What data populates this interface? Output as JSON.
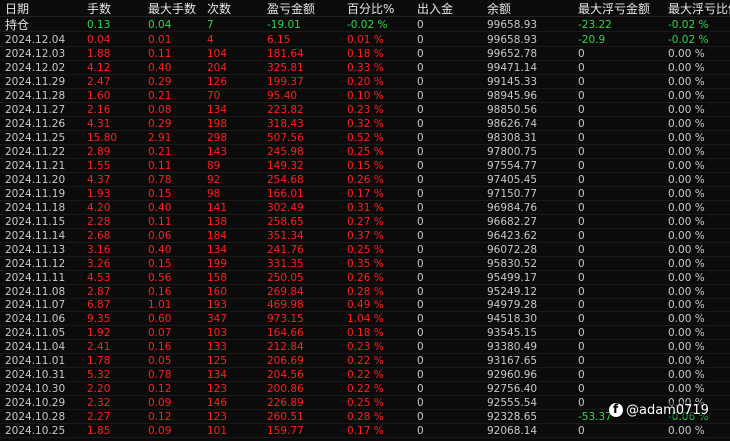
{
  "columns": [
    "日期",
    "手数",
    "最大手数",
    "次数",
    "盈亏金额",
    "百分比%",
    "出入金",
    "余额",
    "最大浮亏金额",
    "最大浮亏比例"
  ],
  "position_row": {
    "date": "持仓",
    "lots": "0.13",
    "max_lots": "0.04",
    "count": "7",
    "profit": "-19.01",
    "pct": "-0.02 %",
    "flow": "0",
    "balance": "99658.93",
    "max_float_loss": "-23.22",
    "max_float_loss_pct": "-0.02 %"
  },
  "rows": [
    {
      "date": "2024.12.04",
      "lots": "0.04",
      "max_lots": "0.01",
      "count": "4",
      "profit": "6.15",
      "pct": "0.01 %",
      "flow": "0",
      "balance": "99658.93",
      "max_float_loss": "-20.9",
      "max_float_loss_pct": "-0.02 %"
    },
    {
      "date": "2024.12.03",
      "lots": "1.88",
      "max_lots": "0.11",
      "count": "104",
      "profit": "181.64",
      "pct": "0.18 %",
      "flow": "0",
      "balance": "99652.78",
      "max_float_loss": "0",
      "max_float_loss_pct": "0.00 %"
    },
    {
      "date": "2024.12.02",
      "lots": "4.12",
      "max_lots": "0.40",
      "count": "204",
      "profit": "325.81",
      "pct": "0.33 %",
      "flow": "0",
      "balance": "99471.14",
      "max_float_loss": "0",
      "max_float_loss_pct": "0.00 %"
    },
    {
      "date": "2024.11.29",
      "lots": "2.47",
      "max_lots": "0.29",
      "count": "126",
      "profit": "199.37",
      "pct": "0.20 %",
      "flow": "0",
      "balance": "99145.33",
      "max_float_loss": "0",
      "max_float_loss_pct": "0.00 %"
    },
    {
      "date": "2024.11.28",
      "lots": "1.60",
      "max_lots": "0.21",
      "count": "70",
      "profit": "95.40",
      "pct": "0.10 %",
      "flow": "0",
      "balance": "98945.96",
      "max_float_loss": "0",
      "max_float_loss_pct": "0.00 %"
    },
    {
      "date": "2024.11.27",
      "lots": "2.16",
      "max_lots": "0.08",
      "count": "134",
      "profit": "223.82",
      "pct": "0.23 %",
      "flow": "0",
      "balance": "98850.56",
      "max_float_loss": "0",
      "max_float_loss_pct": "0.00 %"
    },
    {
      "date": "2024.11.26",
      "lots": "4.31",
      "max_lots": "0.29",
      "count": "198",
      "profit": "318.43",
      "pct": "0.32 %",
      "flow": "0",
      "balance": "98626.74",
      "max_float_loss": "0",
      "max_float_loss_pct": "0.00 %"
    },
    {
      "date": "2024.11.25",
      "lots": "15.80",
      "max_lots": "2.91",
      "count": "298",
      "profit": "507.56",
      "pct": "0.52 %",
      "flow": "0",
      "balance": "98308.31",
      "max_float_loss": "0",
      "max_float_loss_pct": "0.00 %"
    },
    {
      "date": "2024.11.22",
      "lots": "2.89",
      "max_lots": "0.21",
      "count": "143",
      "profit": "245.98",
      "pct": "0.25 %",
      "flow": "0",
      "balance": "97800.75",
      "max_float_loss": "0",
      "max_float_loss_pct": "0.00 %"
    },
    {
      "date": "2024.11.21",
      "lots": "1.55",
      "max_lots": "0.11",
      "count": "89",
      "profit": "149.32",
      "pct": "0.15 %",
      "flow": "0",
      "balance": "97554.77",
      "max_float_loss": "0",
      "max_float_loss_pct": "0.00 %"
    },
    {
      "date": "2024.11.20",
      "lots": "4.37",
      "max_lots": "0.78",
      "count": "92",
      "profit": "254.68",
      "pct": "0.26 %",
      "flow": "0",
      "balance": "97405.45",
      "max_float_loss": "0",
      "max_float_loss_pct": "0.00 %"
    },
    {
      "date": "2024.11.19",
      "lots": "1.93",
      "max_lots": "0.15",
      "count": "98",
      "profit": "166.01",
      "pct": "0.17 %",
      "flow": "0",
      "balance": "97150.77",
      "max_float_loss": "0",
      "max_float_loss_pct": "0.00 %"
    },
    {
      "date": "2024.11.18",
      "lots": "4.20",
      "max_lots": "0.40",
      "count": "141",
      "profit": "302.49",
      "pct": "0.31 %",
      "flow": "0",
      "balance": "96984.76",
      "max_float_loss": "0",
      "max_float_loss_pct": "0.00 %"
    },
    {
      "date": "2024.11.15",
      "lots": "2.28",
      "max_lots": "0.11",
      "count": "138",
      "profit": "258.65",
      "pct": "0.27 %",
      "flow": "0",
      "balance": "96682.27",
      "max_float_loss": "0",
      "max_float_loss_pct": "0.00 %"
    },
    {
      "date": "2024.11.14",
      "lots": "2.68",
      "max_lots": "0.06",
      "count": "184",
      "profit": "351.34",
      "pct": "0.37 %",
      "flow": "0",
      "balance": "96423.62",
      "max_float_loss": "0",
      "max_float_loss_pct": "0.00 %"
    },
    {
      "date": "2024.11.13",
      "lots": "3.16",
      "max_lots": "0.40",
      "count": "134",
      "profit": "241.76",
      "pct": "0.25 %",
      "flow": "0",
      "balance": "96072.28",
      "max_float_loss": "0",
      "max_float_loss_pct": "0.00 %"
    },
    {
      "date": "2024.11.12",
      "lots": "3.26",
      "max_lots": "0.15",
      "count": "199",
      "profit": "331.35",
      "pct": "0.35 %",
      "flow": "0",
      "balance": "95830.52",
      "max_float_loss": "0",
      "max_float_loss_pct": "0.00 %"
    },
    {
      "date": "2024.11.11",
      "lots": "4.53",
      "max_lots": "0.56",
      "count": "158",
      "profit": "250.05",
      "pct": "0.26 %",
      "flow": "0",
      "balance": "95499.17",
      "max_float_loss": "0",
      "max_float_loss_pct": "0.00 %"
    },
    {
      "date": "2024.11.08",
      "lots": "2.87",
      "max_lots": "0.16",
      "count": "160",
      "profit": "269.84",
      "pct": "0.28 %",
      "flow": "0",
      "balance": "95249.12",
      "max_float_loss": "0",
      "max_float_loss_pct": "0.00 %"
    },
    {
      "date": "2024.11.07",
      "lots": "6.87",
      "max_lots": "1.01",
      "count": "193",
      "profit": "469.98",
      "pct": "0.49 %",
      "flow": "0",
      "balance": "94979.28",
      "max_float_loss": "0",
      "max_float_loss_pct": "0.00 %"
    },
    {
      "date": "2024.11.06",
      "lots": "9.35",
      "max_lots": "0.60",
      "count": "347",
      "profit": "973.15",
      "pct": "1.04 %",
      "flow": "0",
      "balance": "94518.30",
      "max_float_loss": "0",
      "max_float_loss_pct": "0.00 %"
    },
    {
      "date": "2024.11.05",
      "lots": "1.92",
      "max_lots": "0.07",
      "count": "103",
      "profit": "164.66",
      "pct": "0.18 %",
      "flow": "0",
      "balance": "93545.15",
      "max_float_loss": "0",
      "max_float_loss_pct": "0.00 %"
    },
    {
      "date": "2024.11.04",
      "lots": "2.41",
      "max_lots": "0.16",
      "count": "133",
      "profit": "212.84",
      "pct": "0.23 %",
      "flow": "0",
      "balance": "93380.49",
      "max_float_loss": "0",
      "max_float_loss_pct": "0.00 %"
    },
    {
      "date": "2024.11.01",
      "lots": "1.78",
      "max_lots": "0.05",
      "count": "125",
      "profit": "206.69",
      "pct": "0.22 %",
      "flow": "0",
      "balance": "93167.65",
      "max_float_loss": "0",
      "max_float_loss_pct": "0.00 %"
    },
    {
      "date": "2024.10.31",
      "lots": "5.32",
      "max_lots": "0.78",
      "count": "134",
      "profit": "204.56",
      "pct": "0.22 %",
      "flow": "0",
      "balance": "92960.96",
      "max_float_loss": "0",
      "max_float_loss_pct": "0.00 %"
    },
    {
      "date": "2024.10.30",
      "lots": "2.20",
      "max_lots": "0.12",
      "count": "123",
      "profit": "200.86",
      "pct": "0.22 %",
      "flow": "0",
      "balance": "92756.40",
      "max_float_loss": "0",
      "max_float_loss_pct": "0.00 %"
    },
    {
      "date": "2024.10.29",
      "lots": "2.32",
      "max_lots": "0.09",
      "count": "146",
      "profit": "226.89",
      "pct": "0.25 %",
      "flow": "0",
      "balance": "92555.54",
      "max_float_loss": "0",
      "max_float_loss_pct": "0.00 %"
    },
    {
      "date": "2024.10.28",
      "lots": "2.27",
      "max_lots": "0.12",
      "count": "123",
      "profit": "260.51",
      "pct": "0.28 %",
      "flow": "0",
      "balance": "92328.65",
      "max_float_loss": "-53.37",
      "max_float_loss_pct": "-0.06 %"
    },
    {
      "date": "2024.10.25",
      "lots": "1.85",
      "max_lots": "0.09",
      "count": "101",
      "profit": "159.77",
      "pct": "0.17 %",
      "flow": "0",
      "balance": "92068.14",
      "max_float_loss": "0",
      "max_float_loss_pct": "0.00 %"
    }
  ],
  "watermark": {
    "text": "@adam0719",
    "icon": "facebook-icon"
  },
  "colors": {
    "background": "#0b0b0b",
    "profit": "#ff2020",
    "position": "#2dd84a",
    "neutral": "#c8c8c8"
  }
}
